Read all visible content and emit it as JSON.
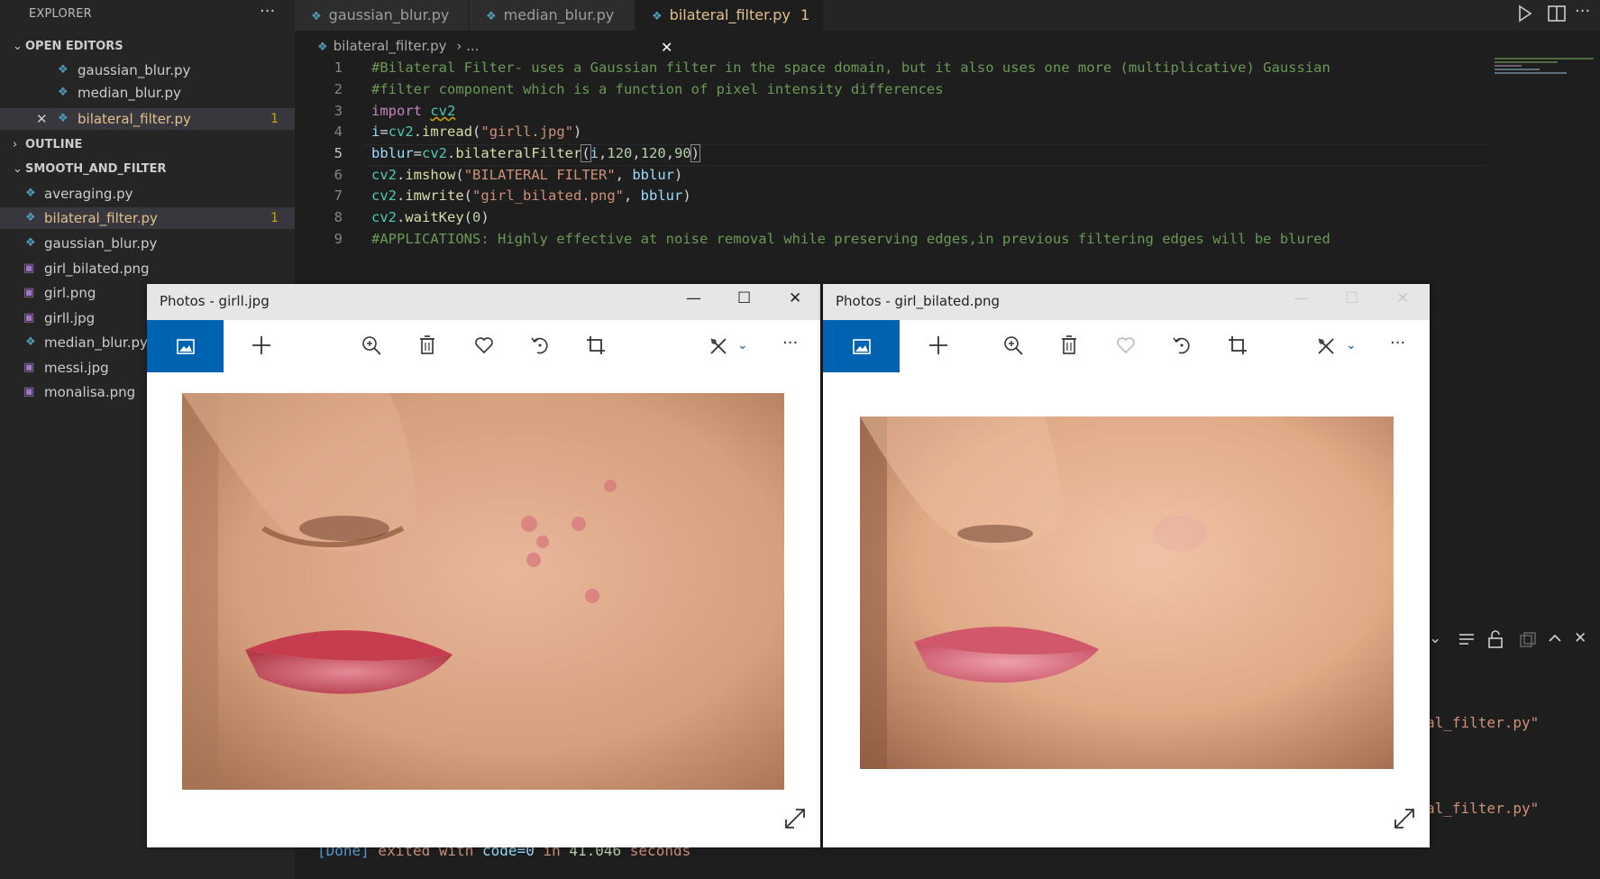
{
  "sidebar": {
    "title": "EXPLORER",
    "more": "···",
    "open_editors": {
      "label": "OPEN EDITORS",
      "items": [
        {
          "name": "gaussian_blur.py"
        },
        {
          "name": "median_blur.py"
        },
        {
          "name": "bilateral_filter.py",
          "badge": "1",
          "close": "✕"
        }
      ]
    },
    "outline": {
      "label": "OUTLINE"
    },
    "folder": {
      "label": "SMOOTH_AND_FILTER",
      "items": [
        {
          "name": "averaging.py"
        },
        {
          "name": "bilateral_filter.py",
          "badge": "1"
        },
        {
          "name": "gaussian_blur.py"
        },
        {
          "name": "girl_bilated.png"
        },
        {
          "name": "girl.png"
        },
        {
          "name": "girll.jpg"
        },
        {
          "name": "median_blur.py"
        },
        {
          "name": "messi.jpg"
        },
        {
          "name": "monalisa.png"
        }
      ]
    }
  },
  "tabs": [
    {
      "label": "gaussian_blur.py"
    },
    {
      "label": "median_blur.py"
    },
    {
      "label": "bilateral_filter.py",
      "badge": "1",
      "close": "✕"
    }
  ],
  "breadcrumb": {
    "file": "bilateral_filter.py",
    "rest": "›  ..."
  },
  "code": {
    "line_numbers": [
      "1",
      "2",
      "3",
      "4",
      "5",
      "6",
      "7",
      "8",
      "9"
    ],
    "lines": [
      "#Bilateral Filter- uses a Gaussian filter in the space domain, but it also uses one more (multiplicative) Gaussian",
      "#filter component which is a function of pixel intensity differences",
      "import cv2",
      "i=cv2.imread(\"girll.jpg\")",
      "bblur=cv2.bilateralFilter(i,120,120,90)",
      "cv2.imshow(\"BILATERAL FILTER\", bblur)",
      "cv2.imwrite(\"girl_bilated.png\", bblur)",
      "cv2.waitKey(0)",
      "#APPLICATIONS: Highly effective at noise removal while preserving edges,in previous filtering edges will be blured"
    ],
    "tokens": {
      "import_kw": "import",
      "cv2": "cv2",
      "i": "i",
      "eq": "=",
      "dot": ".",
      "imread": "imread",
      "imread_arg": "\"girll.jpg\"",
      "bblur": "bblur",
      "bilateralFilter": "bilateralFilter",
      "n120a": "120",
      "n120b": "120",
      "n90": "90",
      "imshow": "imshow",
      "imshow_str": "\"BILATERAL FILTER\"",
      "imwrite": "imwrite",
      "imwrite_str": "\"girl_bilated.png\"",
      "waitKey": "waitKey",
      "zero": "0"
    }
  },
  "terminal": {
    "path_tail_1": "al_filter.py\"",
    "path_tail_2": "al_filter.py\"",
    "done_tag": "[Done]",
    "done_text": " exited with ",
    "code_label": "code=0",
    "in_text": " in ",
    "seconds": "41.046",
    "seconds_label": " seconds"
  },
  "windows": [
    {
      "title": "Photos - girll.jpg",
      "minimize": "—",
      "maximize": "☐",
      "close": "✕"
    },
    {
      "title": "Photos - girl_bilated.png",
      "minimize": "—",
      "maximize": "☐",
      "close": "✕"
    }
  ],
  "colors": {
    "accent_blue": "#0063b1",
    "modified_yellow": "#e2c08d",
    "editor_bg": "#1e1e1e"
  }
}
